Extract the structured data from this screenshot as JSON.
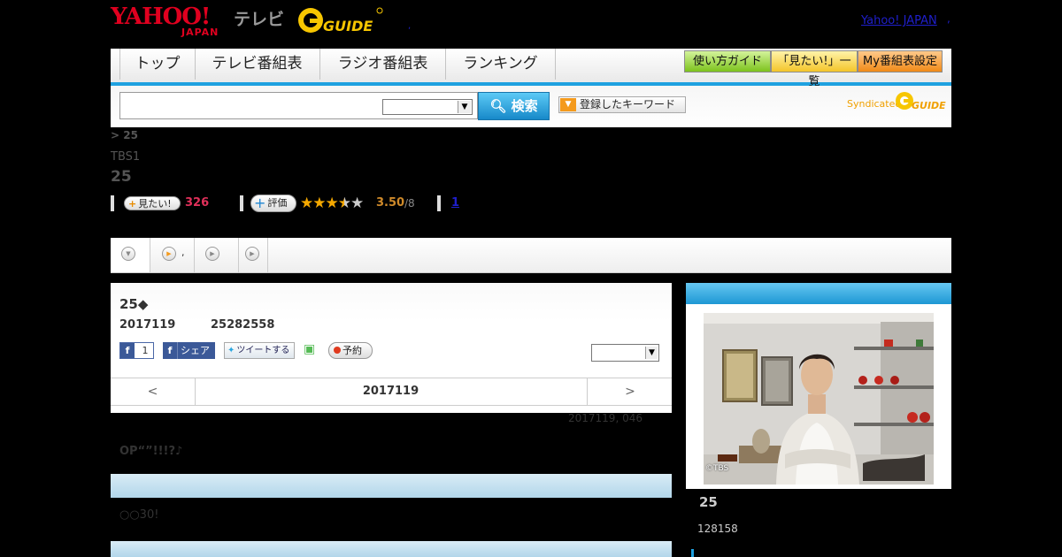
{
  "header": {
    "yahoo_logo": "YAHOO!",
    "yahoo_logo_sub": "JAPAN",
    "tv_label": "テレビ",
    "gguide_logo": "GUIDE",
    "yahoo_japan_link": "Yahoo! JAPAN",
    "link_sep": ",",
    "dot": ","
  },
  "nav": {
    "tabs": [
      "トップ",
      "テレビ番組表",
      "ラジオ番組表",
      "ランキング"
    ],
    "buttons": {
      "guide": "使い方ガイド",
      "mitai_list": "「見たい!」一覧",
      "my_schedule": "My番組表設定"
    }
  },
  "search": {
    "input_value": "",
    "button_label": "検索",
    "keyword_button": "登録したキーワード",
    "syndicated_label": "Syndicated"
  },
  "program": {
    "breadcrumb": "> 25",
    "channel": "TBS1",
    "title": "25",
    "mitai_label": "見たい!",
    "mitai_count": "326",
    "hyoka_label": "評価",
    "rating": 3.5,
    "rating_score": "3.50",
    "rating_total": "/8",
    "review_link": "1"
  },
  "tabs": [
    {
      "label": "",
      "icon": "chevron-down-icon"
    },
    {
      "label": ",",
      "icon": "play-orange-icon"
    },
    {
      "label": "",
      "icon": "play-gray-icon"
    },
    {
      "label": "",
      "icon": "play-gray-icon"
    }
  ],
  "episode": {
    "title": "25◆",
    "date": "2017119",
    "time": "25282558",
    "fb_like_count": "1",
    "fb_share_label": "シェア",
    "tweet_label": "ツイートする",
    "yoyaku_label": "予約",
    "prev_label": "<",
    "nav_date": "2017119",
    "next_label": ">",
    "update_stamp": "2017119, 046",
    "description": "OP“”!!!?♪",
    "section_text": "○○30!"
  },
  "side": {
    "photo_credit": "©TBS",
    "title": "25",
    "subtitle": "128158"
  },
  "colors": {
    "accent_blue": "#1ea1e0",
    "yahoo_red": "#e0001f",
    "rating_star": "#f4a800"
  }
}
